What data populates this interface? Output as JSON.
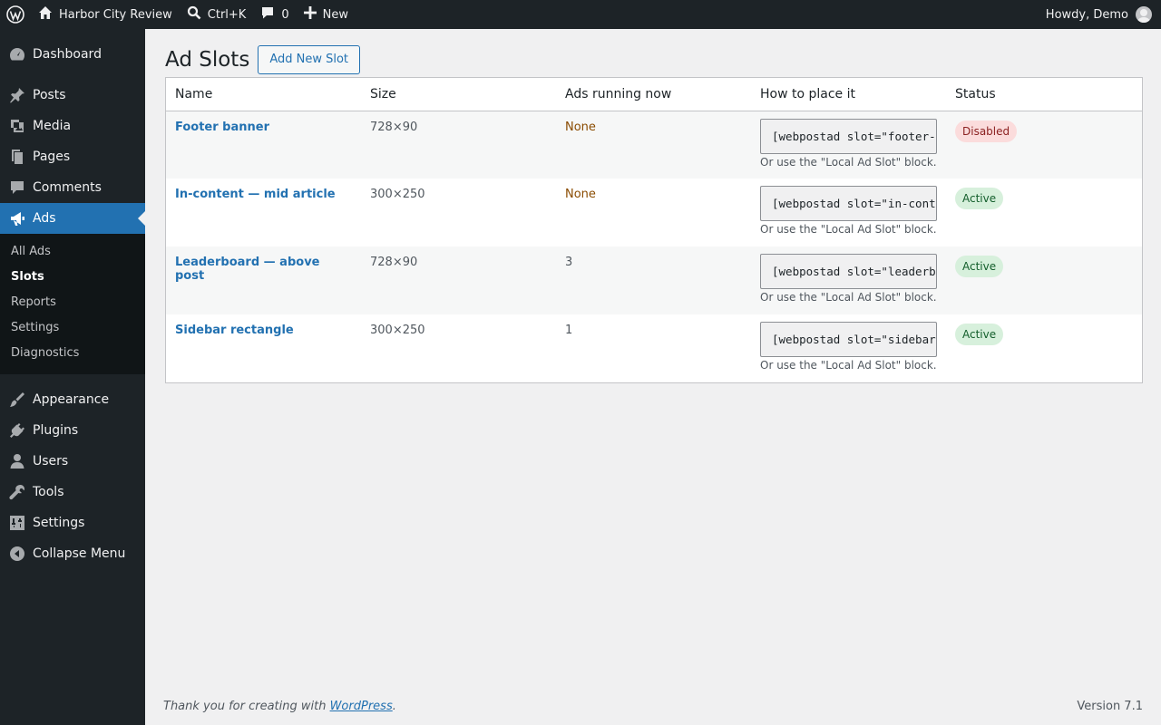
{
  "adminbar": {
    "site_name": "Harbor City Review",
    "search_shortcut": "Ctrl+K",
    "comments_count": "0",
    "new_label": "New",
    "howdy": "Howdy, Demo"
  },
  "sidebar": {
    "items": [
      {
        "label": "Dashboard",
        "icon": "dashboard-icon"
      },
      {
        "label": "Posts",
        "icon": "pin-icon"
      },
      {
        "label": "Media",
        "icon": "media-icon"
      },
      {
        "label": "Pages",
        "icon": "pages-icon"
      },
      {
        "label": "Comments",
        "icon": "comment-icon"
      },
      {
        "label": "Ads",
        "icon": "megaphone-icon"
      }
    ],
    "submenu": [
      "All Ads",
      "Slots",
      "Reports",
      "Settings",
      "Diagnostics"
    ],
    "items_after": [
      {
        "label": "Appearance",
        "icon": "brush-icon"
      },
      {
        "label": "Plugins",
        "icon": "plug-icon"
      },
      {
        "label": "Users",
        "icon": "user-icon"
      },
      {
        "label": "Tools",
        "icon": "wrench-icon"
      },
      {
        "label": "Settings",
        "icon": "sliders-icon"
      },
      {
        "label": "Collapse Menu",
        "icon": "collapse-icon"
      }
    ]
  },
  "page": {
    "title": "Ad Slots",
    "add_button": "Add New Slot"
  },
  "table": {
    "headers": [
      "Name",
      "Size",
      "Ads running now",
      "How to place it",
      "Status"
    ],
    "rows": [
      {
        "name": "Footer banner",
        "size": "728×90",
        "running": "None",
        "code": "[webpostad slot=\"footer-banner\"]",
        "hint": "Or use the \"Local Ad Slot\" block.",
        "status": "Disabled"
      },
      {
        "name": "In-content — mid article",
        "size": "300×250",
        "running": "None",
        "code": "[webpostad slot=\"in-content-mid-article\"]",
        "hint": "Or use the \"Local Ad Slot\" block.",
        "status": "Active"
      },
      {
        "name": "Leaderboard — above post",
        "size": "728×90",
        "running": "3",
        "code": "[webpostad slot=\"leaderboard-above-post\"]",
        "hint": "Or use the \"Local Ad Slot\" block.",
        "status": "Active"
      },
      {
        "name": "Sidebar rectangle",
        "size": "300×250",
        "running": "1",
        "code": "[webpostad slot=\"sidebar-rectangle\"]",
        "hint": "Or use the \"Local Ad Slot\" block.",
        "status": "Active"
      }
    ]
  },
  "footer": {
    "thanks_prefix": "Thank you for creating with ",
    "thanks_link": "WordPress",
    "thanks_suffix": ".",
    "version": "Version 7.1"
  },
  "colors": {
    "admin_dark": "#1d2327",
    "accent": "#2271b1",
    "active_badge": "#d7f0dc",
    "disabled_badge": "#fbdcdc"
  }
}
